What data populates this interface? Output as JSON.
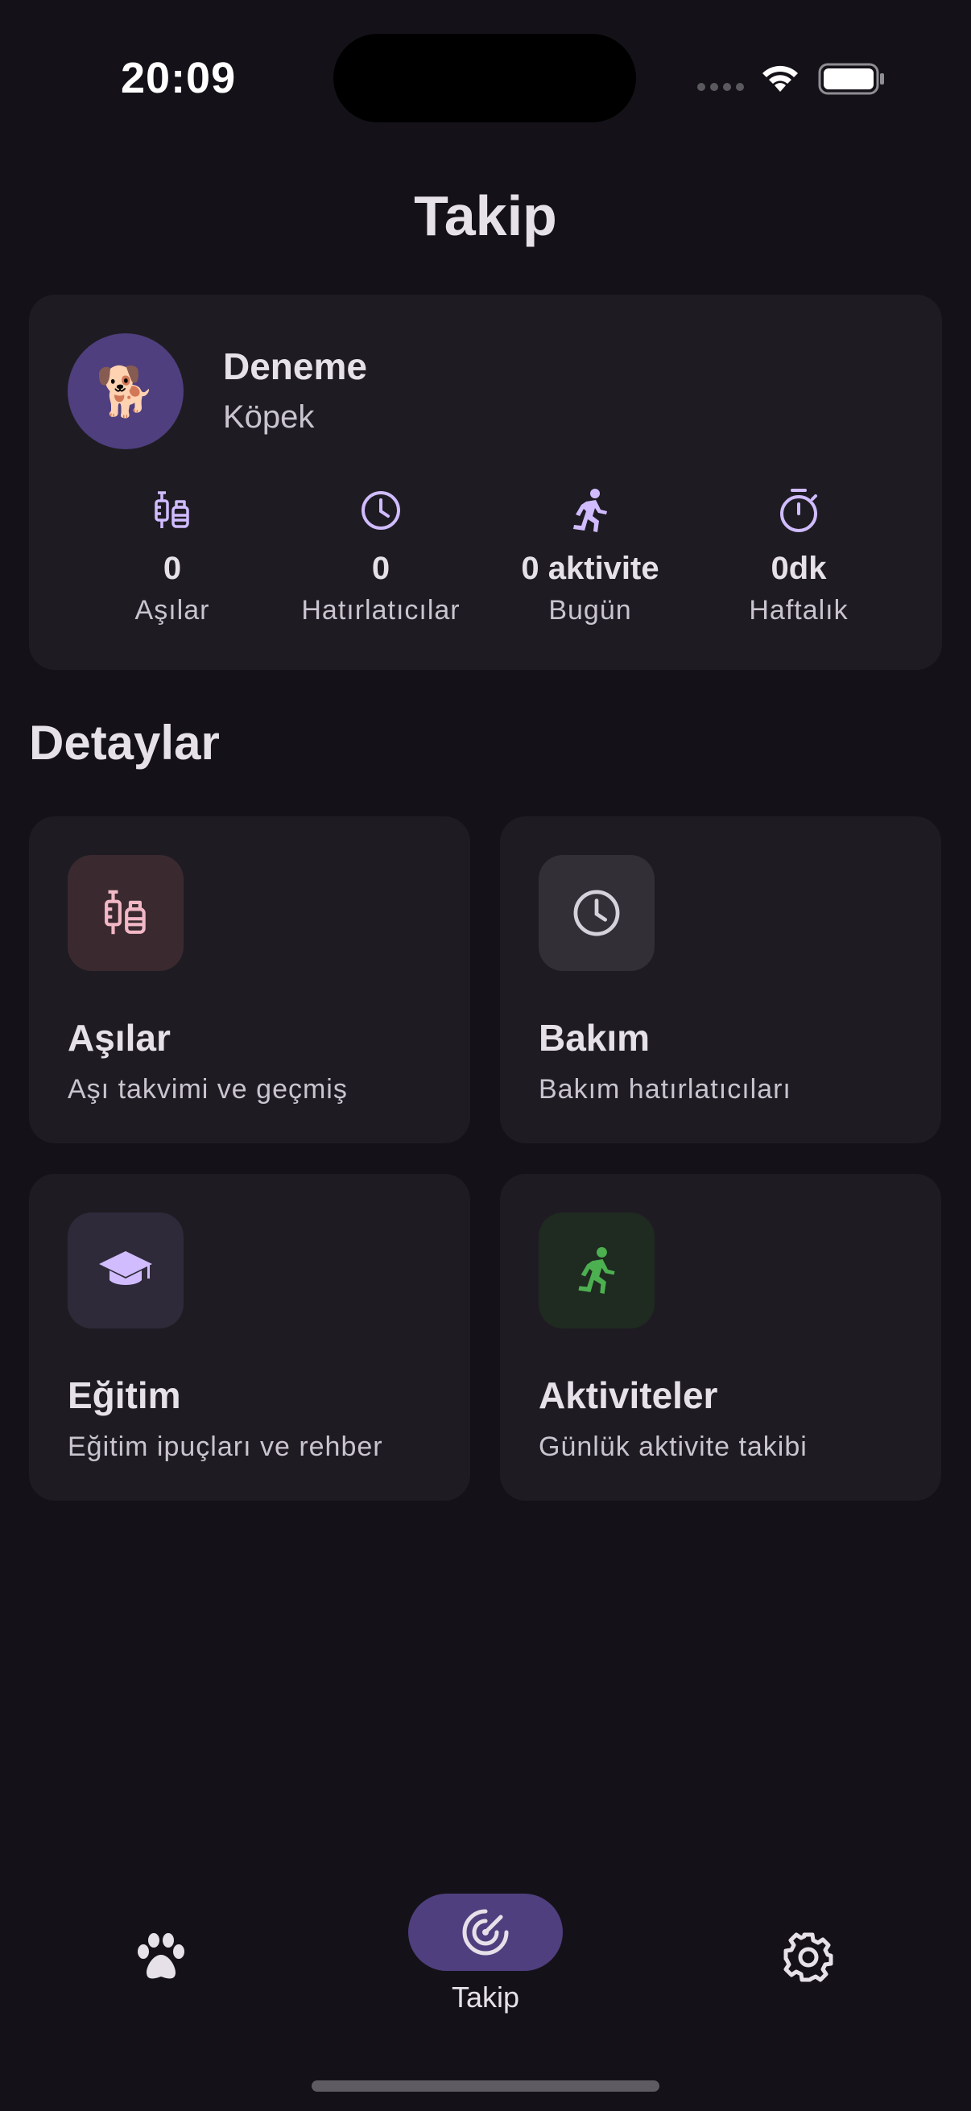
{
  "status_bar": {
    "time": "20:09"
  },
  "header": {
    "title": "Takip"
  },
  "pet": {
    "name": "Deneme",
    "type": "Köpek",
    "avatar_emoji": "🐕",
    "avatar_bg": "#4f3f7e"
  },
  "stats": [
    {
      "icon": "vaccine-icon",
      "value": "0",
      "label": "Aşılar"
    },
    {
      "icon": "clock-icon",
      "value": "0",
      "label": "Hatırlatıcılar"
    },
    {
      "icon": "running-icon",
      "value": "0 aktivite",
      "label": "Bugün"
    },
    {
      "icon": "timer-icon",
      "value": "0dk",
      "label": "Haftalık"
    }
  ],
  "section": {
    "title": "Detaylar"
  },
  "tiles": [
    {
      "icon": "vaccine-icon",
      "title": "Aşılar",
      "subtitle": "Aşı takvimi ve geçmiş",
      "accent": "#f2b8c6",
      "icon_bg": "#3a2a30"
    },
    {
      "icon": "clock-icon",
      "title": "Bakım",
      "subtitle": "Bakım hatırlatıcıları",
      "accent": "#d6d2dc",
      "icon_bg": "#322f37"
    },
    {
      "icon": "graduation-cap-icon",
      "title": "Eğitim",
      "subtitle": "Eğitim ipuçları ve rehber",
      "accent": "#d0bcff",
      "icon_bg": "#2e2a3a"
    },
    {
      "icon": "running-icon",
      "title": "Aktiviteler",
      "subtitle": "Günlük aktivite takibi",
      "accent": "#4caf50",
      "icon_bg": "#1f2a20"
    }
  ],
  "bottom_nav": {
    "items": [
      {
        "icon": "paw-icon",
        "label": ""
      },
      {
        "icon": "radar-icon",
        "label": "Takip",
        "selected": true
      },
      {
        "icon": "gear-icon",
        "label": ""
      }
    ]
  },
  "colors": {
    "background": "#141218",
    "card": "#1e1c22",
    "accent_purple": "#d0bcff",
    "selected_pill": "#4f3f7e"
  }
}
